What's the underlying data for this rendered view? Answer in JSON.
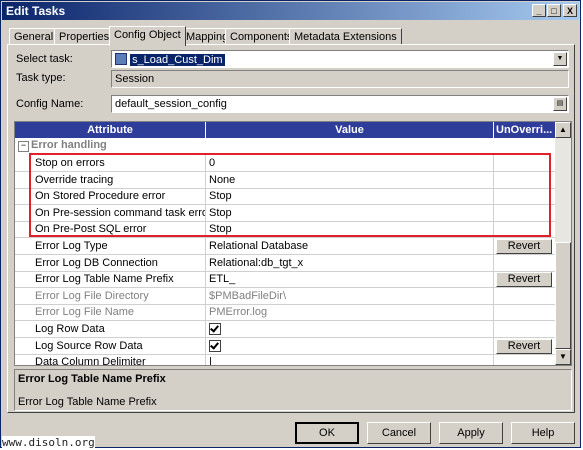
{
  "window": {
    "title": "Edit Tasks"
  },
  "title_buttons": {
    "minimize": "_",
    "maximize": "□",
    "close": "X"
  },
  "tabs": [
    {
      "label": "General"
    },
    {
      "label": "Properties"
    },
    {
      "label": "Config Object"
    },
    {
      "label": "Mapping"
    },
    {
      "label": "Components"
    },
    {
      "label": "Metadata Extensions"
    }
  ],
  "active_tab": "Config Object",
  "select_task": {
    "label": "Select task:",
    "value": "s_Load_Cust_Dim"
  },
  "task_type": {
    "label": "Task type:",
    "value": "Session"
  },
  "config_name": {
    "label": "Config Name:",
    "value": "default_session_config"
  },
  "grid": {
    "headers": {
      "attribute": "Attribute",
      "value": "Value",
      "unoverride": "UnOverri..."
    },
    "group": {
      "label": "Error handling",
      "toggle": "−"
    },
    "rows": [
      {
        "attribute": "Stop on errors",
        "value": "0",
        "revert": ""
      },
      {
        "attribute": "Override tracing",
        "value": "None",
        "revert": ""
      },
      {
        "attribute": "On Stored Procedure error",
        "value": "Stop",
        "revert": ""
      },
      {
        "attribute": "On Pre-session command task error",
        "value": "Stop",
        "revert": ""
      },
      {
        "attribute": "On Pre-Post SQL error",
        "value": "Stop",
        "revert": ""
      },
      {
        "attribute": "Error Log Type",
        "value": "Relational Database",
        "revert": "Revert"
      },
      {
        "attribute": "Error Log DB Connection",
        "value": "Relational:db_tgt_x",
        "revert": ""
      },
      {
        "attribute": "Error Log Table Name Prefix",
        "value": "ETL_",
        "revert": "Revert"
      },
      {
        "attribute": "Error Log File Directory",
        "value": "$PMBadFileDir\\",
        "revert": ""
      },
      {
        "attribute": "Error Log File Name",
        "value": "PMError.log",
        "revert": ""
      },
      {
        "attribute": "Log Row Data",
        "value": "",
        "revert": ""
      },
      {
        "attribute": "Log Source Row Data",
        "value": "",
        "revert": "Revert"
      },
      {
        "attribute": "Data Column Delimiter",
        "value": "|",
        "revert": ""
      }
    ]
  },
  "description": {
    "title": "Error Log Table Name Prefix",
    "text": "Error Log Table Name Prefix"
  },
  "buttons": {
    "ok": "OK",
    "cancel": "Cancel",
    "apply": "Apply",
    "help": "Help"
  },
  "watermark": "www.disoln.org"
}
